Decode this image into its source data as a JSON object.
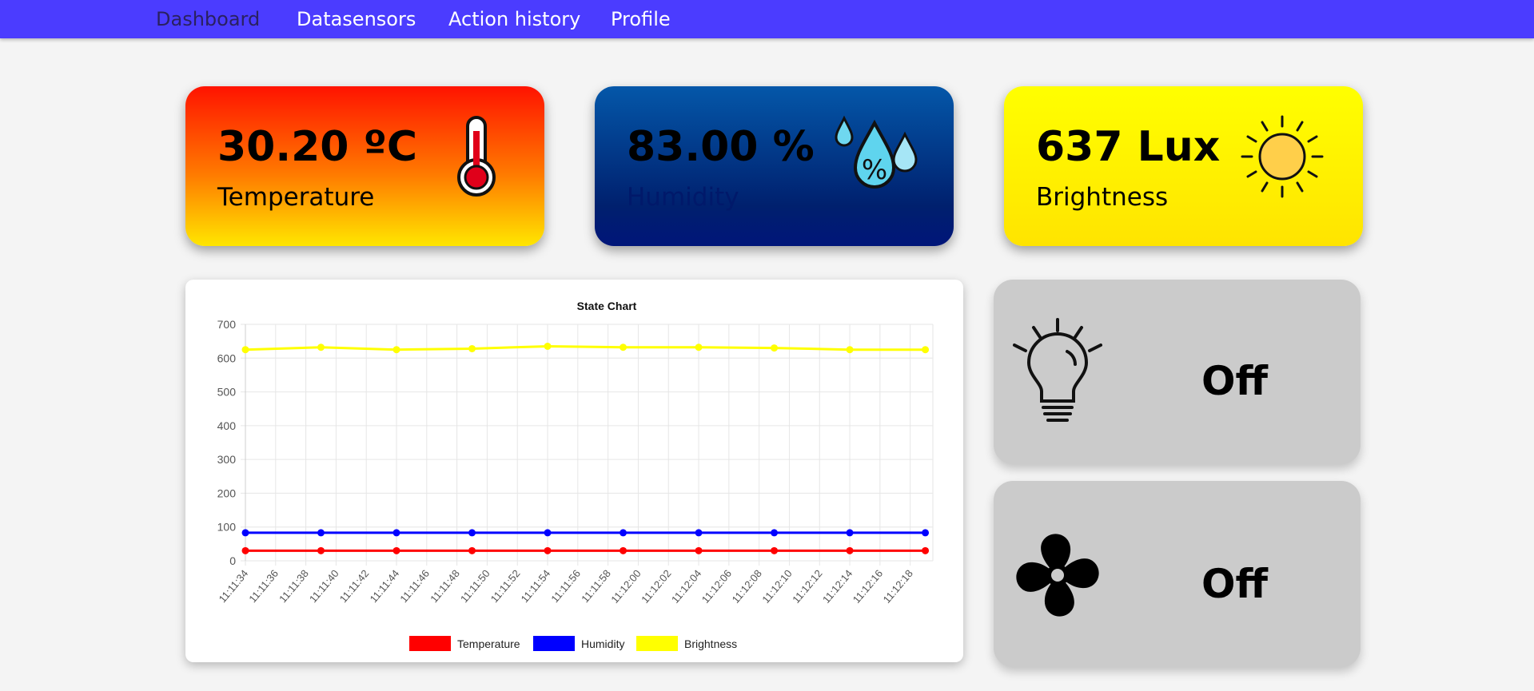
{
  "nav": {
    "items": [
      {
        "label": "Dashboard"
      },
      {
        "label": "Datasensors"
      },
      {
        "label": "Action history"
      },
      {
        "label": "Profile"
      }
    ]
  },
  "stats": {
    "temperature": {
      "value": "30.20 ºC",
      "label": "Temperature",
      "icon": "thermometer-icon"
    },
    "humidity": {
      "value": "83.00 %",
      "label": "Humidity",
      "icon": "humidity-drops-icon"
    },
    "brightness": {
      "value": "637 Lux",
      "label": "Brightness",
      "icon": "sun-icon"
    }
  },
  "devices": {
    "light": {
      "status": "Off",
      "icon": "light-bulb-icon"
    },
    "fan": {
      "status": "Off",
      "icon": "fan-icon"
    }
  },
  "colors": {
    "nav": "#4b3cff",
    "temperature": "#ff0000",
    "humidity": "#0000ff",
    "brightness": "#ffff00"
  },
  "chart_data": {
    "type": "line",
    "title": "State Chart",
    "ylim": [
      0,
      700
    ],
    "y_ticks": [
      0,
      100,
      200,
      300,
      400,
      500,
      600,
      700
    ],
    "x": [
      "11:11:34",
      "11:11:36",
      "11:11:38",
      "11:11:40",
      "11:11:42",
      "11:11:44",
      "11:11:46",
      "11:11:48",
      "11:11:50",
      "11:11:52",
      "11:11:54",
      "11:11:56",
      "11:11:58",
      "11:12:00",
      "11:12:02",
      "11:12:04",
      "11:12:06",
      "11:12:08",
      "11:12:10",
      "11:12:12",
      "11:12:14",
      "11:12:16",
      "11:12:18"
    ],
    "grid": true,
    "legend": "bottom",
    "series": [
      {
        "name": "Temperature",
        "color": "#ff0000",
        "points": [
          [
            "11:11:34",
            30
          ],
          [
            "11:11:39",
            30
          ],
          [
            "11:11:44",
            30
          ],
          [
            "11:11:49",
            30
          ],
          [
            "11:11:54",
            30
          ],
          [
            "11:11:59",
            30
          ],
          [
            "11:12:04",
            30
          ],
          [
            "11:12:09",
            30
          ],
          [
            "11:12:14",
            30
          ],
          [
            "11:12:19",
            30
          ]
        ]
      },
      {
        "name": "Humidity",
        "color": "#0000ff",
        "points": [
          [
            "11:11:34",
            83
          ],
          [
            "11:11:39",
            83
          ],
          [
            "11:11:44",
            83
          ],
          [
            "11:11:49",
            83
          ],
          [
            "11:11:54",
            83
          ],
          [
            "11:11:59",
            83
          ],
          [
            "11:12:04",
            83
          ],
          [
            "11:12:09",
            83
          ],
          [
            "11:12:14",
            83
          ],
          [
            "11:12:19",
            83
          ]
        ]
      },
      {
        "name": "Brightness",
        "color": "#ffff00",
        "points": [
          [
            "11:11:34",
            625
          ],
          [
            "11:11:39",
            632
          ],
          [
            "11:11:44",
            625
          ],
          [
            "11:11:49",
            628
          ],
          [
            "11:11:54",
            635
          ],
          [
            "11:11:59",
            632
          ],
          [
            "11:12:04",
            632
          ],
          [
            "11:12:09",
            630
          ],
          [
            "11:12:14",
            625
          ],
          [
            "11:12:19",
            625
          ]
        ]
      }
    ]
  }
}
